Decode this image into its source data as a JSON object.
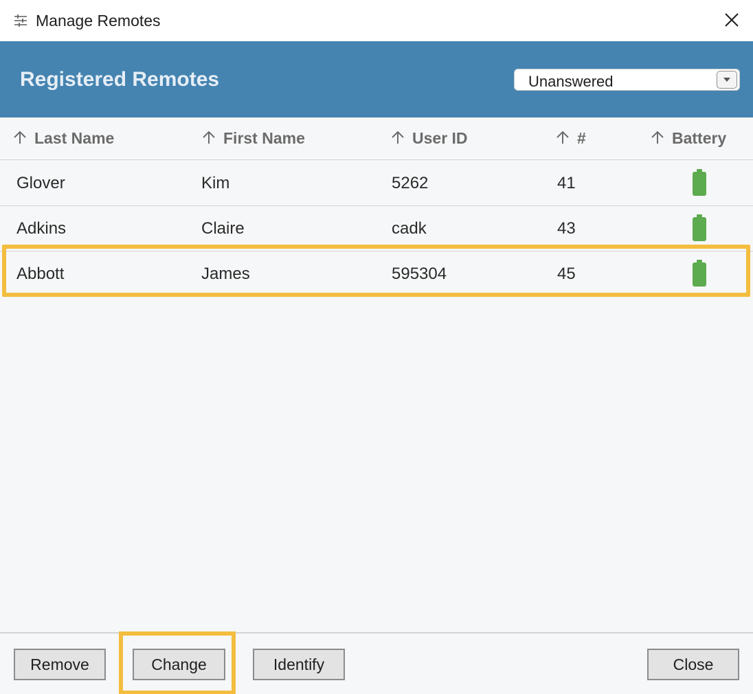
{
  "window": {
    "title": "Manage Remotes",
    "app_icon": "sliders-icon",
    "close_icon": "close-icon"
  },
  "header": {
    "title": "Registered Remotes",
    "filter": {
      "selected": "Unanswered",
      "icon": "chevron-down-icon"
    },
    "color": "#4584b1"
  },
  "table": {
    "columns": [
      {
        "label": "Last Name",
        "sort_icon": "arrow-up-icon"
      },
      {
        "label": "First Name",
        "sort_icon": "arrow-up-icon"
      },
      {
        "label": "User ID",
        "sort_icon": "arrow-up-icon"
      },
      {
        "label": "#",
        "sort_icon": "arrow-up-icon"
      },
      {
        "label": "Battery",
        "sort_icon": "arrow-up-icon"
      }
    ],
    "rows": [
      {
        "last_name": "Glover",
        "first_name": "Kim",
        "user_id": "5262",
        "number": "41",
        "battery_icon": "battery-full-icon",
        "battery_level": 1.0
      },
      {
        "last_name": "Adkins",
        "first_name": "Claire",
        "user_id": "cadk",
        "number": "43",
        "battery_icon": "battery-full-icon",
        "battery_level": 1.0
      },
      {
        "last_name": "Abbott",
        "first_name": "James",
        "user_id": "595304",
        "number": "45",
        "battery_icon": "battery-full-icon",
        "battery_level": 1.0,
        "highlighted": true
      }
    ],
    "battery_color": "#5cab4f"
  },
  "footer": {
    "remove_label": "Remove",
    "change_label": "Change",
    "identify_label": "Identify",
    "close_label": "Close"
  },
  "highlight_color": "#f3bd3f"
}
